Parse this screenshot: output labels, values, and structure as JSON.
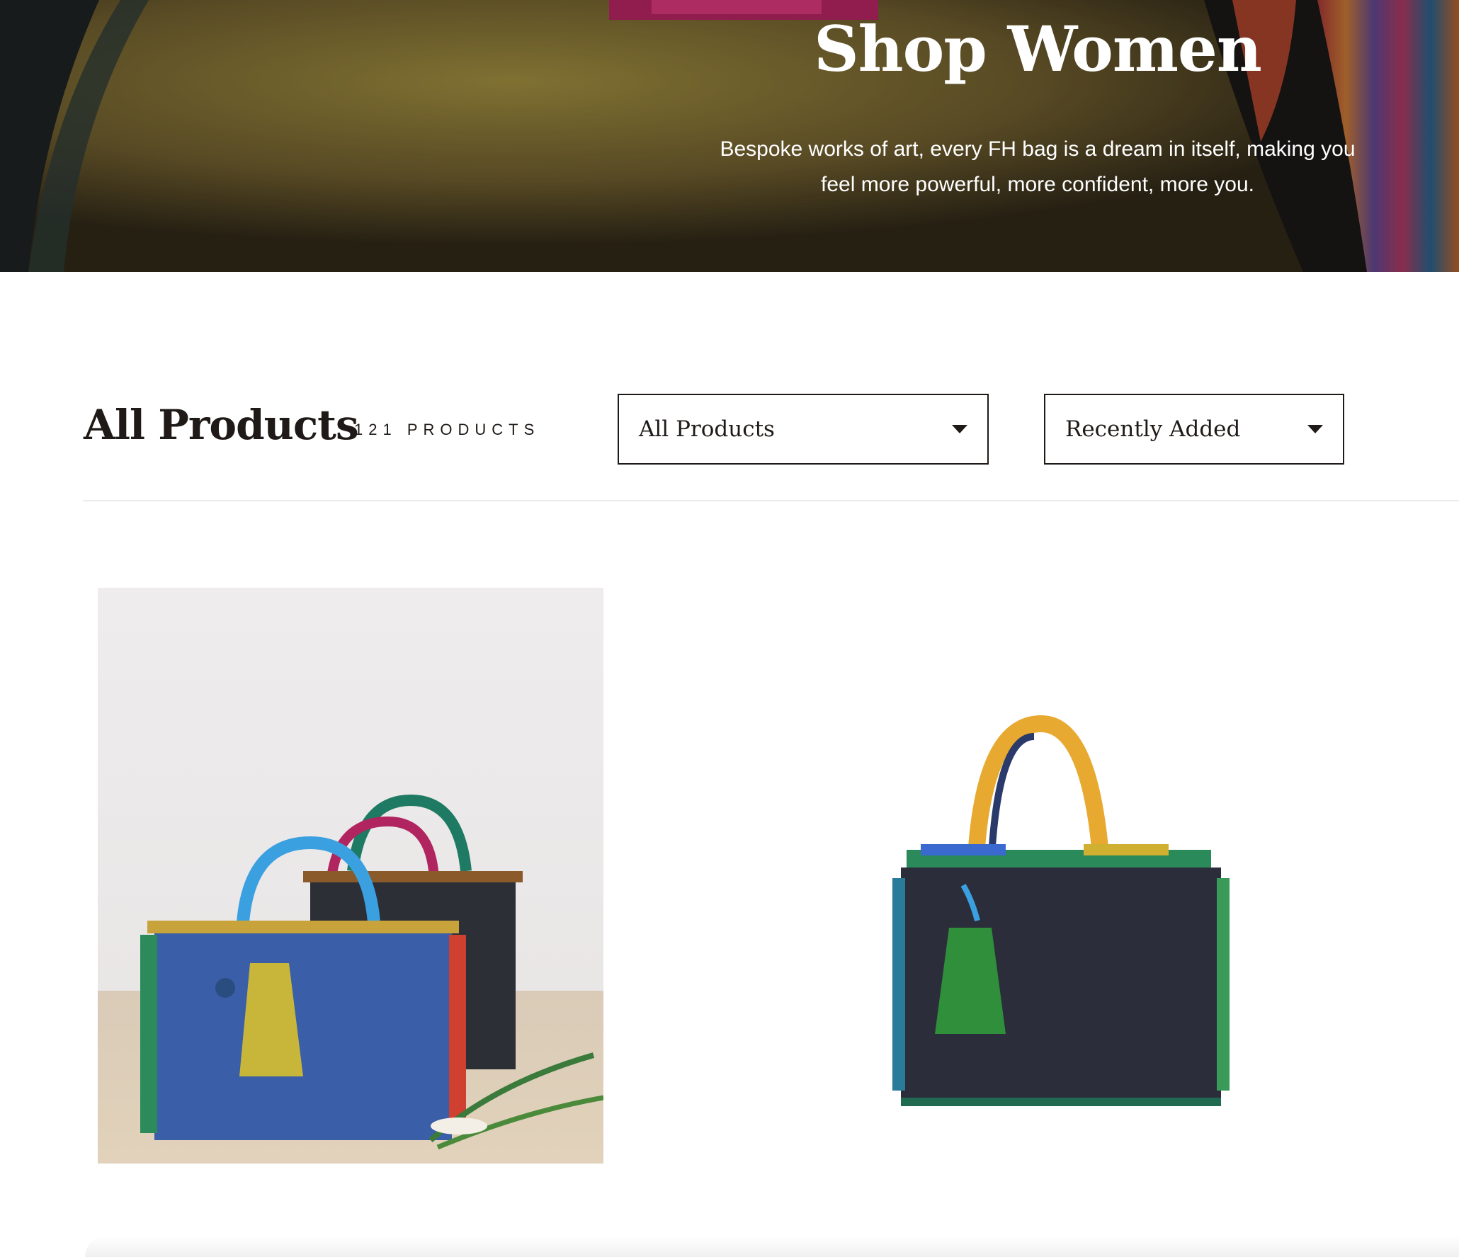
{
  "hero": {
    "title": "Shop Women",
    "subtitle_line1": "Bespoke works of art, every FH bag is a dream in itself, making you",
    "subtitle_line2": "feel more powerful, more confident, more you."
  },
  "toolbar": {
    "title": "All Products",
    "count": "121 PRODUCTS",
    "filter": {
      "selected": "All Products"
    },
    "sort": {
      "selected": "Recently Added"
    }
  },
  "icons": {
    "dropdown": "caret-down-icon"
  },
  "colors": {
    "text": "#1f1a17",
    "divider": "#ececec",
    "hero_overlay": "#5a4a28"
  }
}
